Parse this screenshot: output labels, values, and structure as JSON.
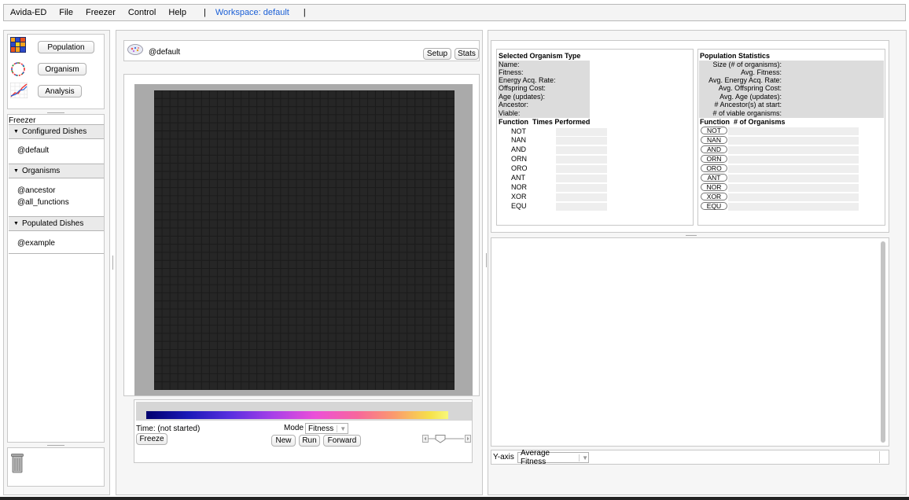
{
  "menu": {
    "items": [
      "Avida-ED",
      "File",
      "Freezer",
      "Control",
      "Help"
    ],
    "separator": "|",
    "workspace": "Workspace: default"
  },
  "nav": {
    "population": "Population",
    "organism": "Organism",
    "analysis": "Analysis"
  },
  "freezer": {
    "title": "Freezer",
    "configured_label": "Configured Dishes",
    "configured_items": [
      "@default"
    ],
    "organisms_label": "Organisms",
    "organism_items": [
      "@ancestor",
      "@all_functions"
    ],
    "populated_label": "Populated Dishes",
    "populated_items": [
      "@example"
    ]
  },
  "dish": {
    "name": "@default",
    "setup": "Setup",
    "stats": "Stats",
    "time": "Time: (not started)",
    "mode_label": "Mode",
    "mode_value": "Fitness",
    "freeze": "Freeze",
    "new": "New",
    "run": "Run",
    "forward": "Forward",
    "grid_cols": 38,
    "grid_rows": 37
  },
  "organism_type": {
    "title": "Selected Organism Type",
    "fields": [
      "Name:",
      "Fitness:",
      "Energy Acq. Rate:",
      "Offspring Cost:",
      "Age (updates):",
      "Ancestor:",
      "Viable:"
    ],
    "function_header": "Function  Times Performed"
  },
  "population_stats": {
    "title": "Population Statistics",
    "fields": [
      "Size (# of organisms):",
      "Avg. Fitness:",
      "Avg. Energy Acq. Rate:",
      "Avg. Offspring Cost:",
      "Avg. Age (updates):",
      "# Ancestor(s) at start:",
      "# of viable organisms:"
    ],
    "function_header": "Function  # of Organisms"
  },
  "functions": [
    "NOT",
    "NAN",
    "AND",
    "ORN",
    "ORO",
    "ANT",
    "NOR",
    "XOR",
    "EQU"
  ],
  "graph": {
    "yaxis_label": "Y-axis",
    "yaxis_value": "Average Fitness"
  },
  "colors": {
    "grid_bg": "#262626",
    "grid_border": "#1b1b1b",
    "dish_surround": "#aaaaaa",
    "workspace_link": "#1a5fd6"
  }
}
